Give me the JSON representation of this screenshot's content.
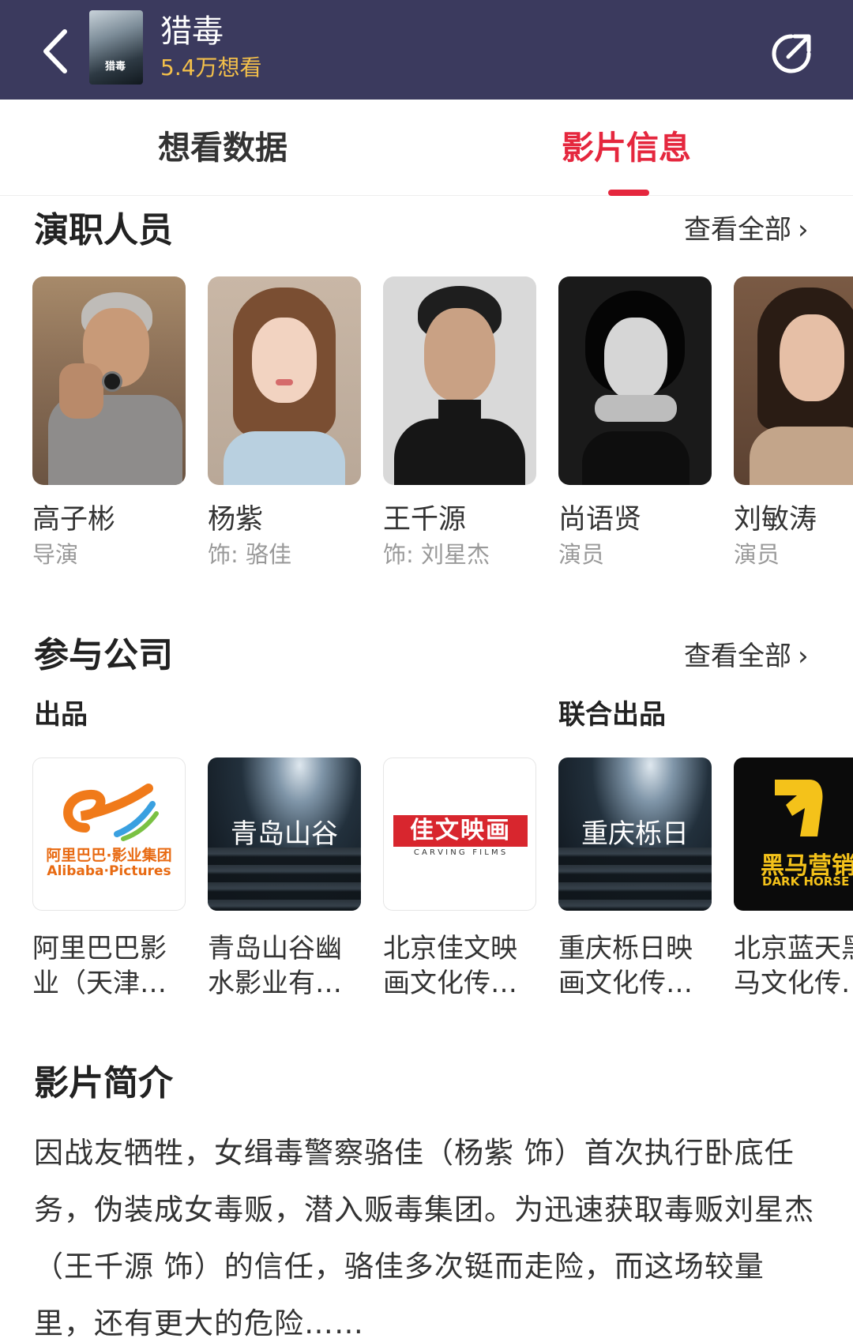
{
  "header": {
    "title": "猎毒",
    "want_count": "5.4万想看",
    "poster_text": "猎毒",
    "background_color": "#3b3a5e",
    "want_color": "#f4c04a"
  },
  "tabs": [
    {
      "label": "想看数据",
      "active": false
    },
    {
      "label": "影片信息",
      "active": true
    }
  ],
  "accent_color": "#e5273e",
  "cast_section": {
    "title": "演职人员",
    "view_all": "查看全部",
    "members": [
      {
        "name": "高子彬",
        "role": "导演"
      },
      {
        "name": "杨紫",
        "role": "饰: 骆佳"
      },
      {
        "name": "王千源",
        "role": "饰: 刘星杰"
      },
      {
        "name": "尚语贤",
        "role": "演员"
      },
      {
        "name": "刘敏涛",
        "role": "演员"
      }
    ]
  },
  "company_section": {
    "title": "参与公司",
    "view_all": "查看全部",
    "label_produce": "出品",
    "label_coproduce": "联合出品",
    "companies": [
      {
        "name": "阿里巴巴影\n业（天津…",
        "logo_line1": "阿里巴巴·影业集团",
        "logo_line2": "Alibaba·Pictures"
      },
      {
        "name": "青岛山谷幽\n水影业有…",
        "logo_text": "青岛山谷"
      },
      {
        "name": "北京佳文映\n画文化传…",
        "logo_line1": "佳文映画",
        "logo_line2": "C A R V I N G   F I L M S"
      },
      {
        "name": "重庆栎日映\n画文化传…",
        "logo_text": "重庆栎日"
      },
      {
        "name": "北京蓝天黑\n马文化传…",
        "logo_line1": "黑马营销",
        "logo_line2": "DARK HORSE"
      }
    ]
  },
  "synopsis_section": {
    "title": "影片简介",
    "text": "因战友牺牲，女缉毒警察骆佳（杨紫 饰）首次执行卧底任务，伪装成女毒贩，潜入贩毒集团。为迅速获取毒贩刘星杰（王千源 饰）的信任，骆佳多次铤而走险，而这场较量里，还有更大的危险……"
  }
}
